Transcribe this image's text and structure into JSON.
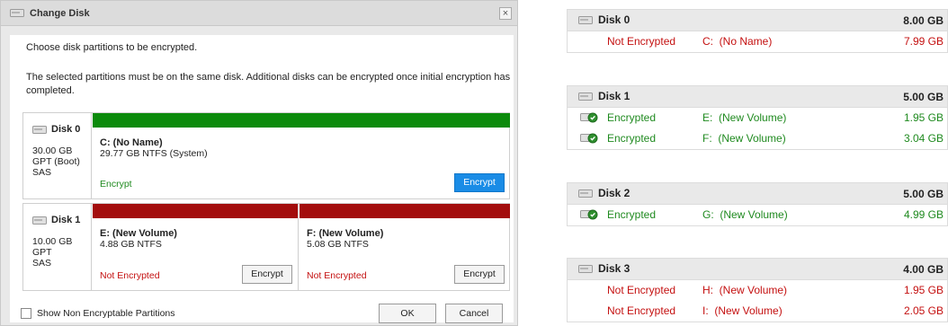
{
  "dialog": {
    "title": "Change Disk",
    "close": "×",
    "intro": "Choose disk partitions to be encrypted.",
    "note": "The selected partitions must be on the same disk. Additional disks can be encrypted once initial encryption has completed.",
    "show_non_encryptable": "Show Non Encryptable Partitions",
    "ok": "OK",
    "cancel": "Cancel"
  },
  "disks": [
    {
      "name": "Disk 0",
      "size": "30.00 GB",
      "type": "GPT (Boot)",
      "bus": "SAS",
      "partitions": [
        {
          "name": "C: (No Name)",
          "detail": "29.77 GB NTFS (System)",
          "status": "Encrypt",
          "button": "Encrypt",
          "bar_color": "#0b8a0b"
        }
      ]
    },
    {
      "name": "Disk 1",
      "size": "10.00 GB",
      "type": "GPT",
      "bus": "SAS",
      "partitions": [
        {
          "name": "E: (New Volume)",
          "detail": "4.88 GB NTFS",
          "status": "Not Encrypted",
          "button": "Encrypt",
          "bar_color": "#a30d0d"
        },
        {
          "name": "F: (New Volume)",
          "detail": "5.08 GB NTFS",
          "status": "Not Encrypted",
          "button": "Encrypt",
          "bar_color": "#a30d0d"
        }
      ]
    }
  ],
  "summary": [
    {
      "name": "Disk 0",
      "size": "8.00 GB",
      "rows": [
        {
          "status": "Not Encrypted",
          "letter": "C:",
          "label": "(No Name)",
          "size": "7.99 GB",
          "encrypted": false
        }
      ]
    },
    {
      "name": "Disk 1",
      "size": "5.00 GB",
      "rows": [
        {
          "status": "Encrypted",
          "letter": "E:",
          "label": "(New Volume)",
          "size": "1.95 GB",
          "encrypted": true
        },
        {
          "status": "Encrypted",
          "letter": "F:",
          "label": "(New Volume)",
          "size": "3.04 GB",
          "encrypted": true
        }
      ]
    },
    {
      "name": "Disk 2",
      "size": "5.00 GB",
      "rows": [
        {
          "status": "Encrypted",
          "letter": "G:",
          "label": "(New Volume)",
          "size": "4.99 GB",
          "encrypted": true
        }
      ]
    },
    {
      "name": "Disk 3",
      "size": "4.00 GB",
      "rows": [
        {
          "status": "Not Encrypted",
          "letter": "H:",
          "label": "(New Volume)",
          "size": "1.95 GB",
          "encrypted": false
        },
        {
          "status": "Not Encrypted",
          "letter": "I:",
          "label": "(New Volume)",
          "size": "2.05 GB",
          "encrypted": false
        }
      ]
    }
  ],
  "colors": {
    "encrypted": "#1f8a1f",
    "not_encrypted": "#c41010",
    "primary_button": "#1a8ce6"
  },
  "icons": {
    "disk": "disk-drive-icon",
    "encrypted": "encrypted-disk-icon"
  }
}
